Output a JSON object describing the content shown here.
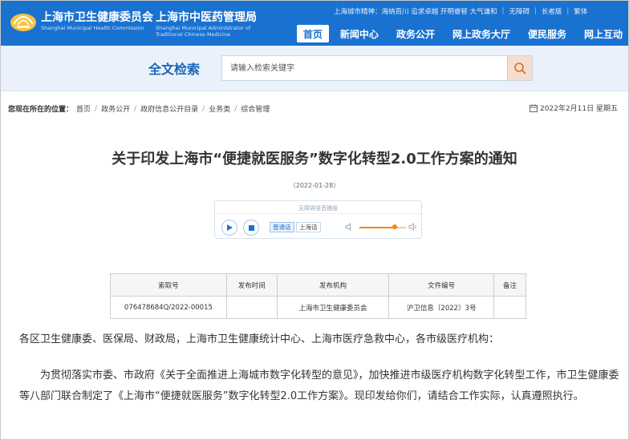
{
  "header": {
    "org_name_1": "上海市卫生健康委员会",
    "org_name_en_1": "Shanghai Municipal Health Commission",
    "org_name_2": "上海市中医药管理局",
    "org_name_en_2": "Shanghai Municipal Administrator of Traditional Chinese Medicine",
    "city_spirit": "上海城市精神：海纳百川 追求卓越 开明睿智 大气谦和",
    "accessibility": "无障碍",
    "elder_mode": "长者版",
    "traditional": "繁体",
    "nav": [
      "首页",
      "新闻中心",
      "政务公开",
      "网上政务大厅",
      "便民服务",
      "网上互动"
    ],
    "active_nav_index": 0,
    "colors": {
      "primary": "#1a72d0",
      "accent": "#f0891a"
    }
  },
  "search": {
    "title": "全文检索",
    "placeholder": "请输入检索关键字",
    "button_icon": "search-icon"
  },
  "breadcrumb": {
    "label": "您现在所在的位置：",
    "items": [
      "首页",
      "政务公开",
      "政府信息公开目录",
      "业务类",
      "综合管理"
    ]
  },
  "current_date": "2022年2月11日 星期五",
  "article": {
    "title": "关于印发上海市“便捷就医服务”数字化转型2.0工作方案的通知",
    "date": "（2022-01-28）"
  },
  "player": {
    "title": "无障碍语音播报",
    "lang_1": "普通话",
    "lang_2": "上海话",
    "volume": 0.75
  },
  "doc_table": {
    "headers": [
      "索取号",
      "发布时间",
      "发布机构",
      "文件编号",
      "备注"
    ],
    "row": [
      "076478684Q/2022-00015",
      "",
      "上海市卫生健康委员会",
      "沪卫信息〔2022〕3号",
      ""
    ]
  },
  "body": {
    "p1": "各区卫生健康委、医保局、财政局，上海市卫生健康统计中心、上海市医疗急救中心，各市级医疗机构：",
    "p2": "为贯彻落实市委、市政府《关于全面推进上海城市数字化转型的意见》，加快推进市级医疗机构数字化转型工作，市卫生健康委等八部门联合制定了《上海市“便捷就医服务”数字化转型2.0工作方案》。现印发给你们，请结合工作实际，认真遵照执行。"
  }
}
